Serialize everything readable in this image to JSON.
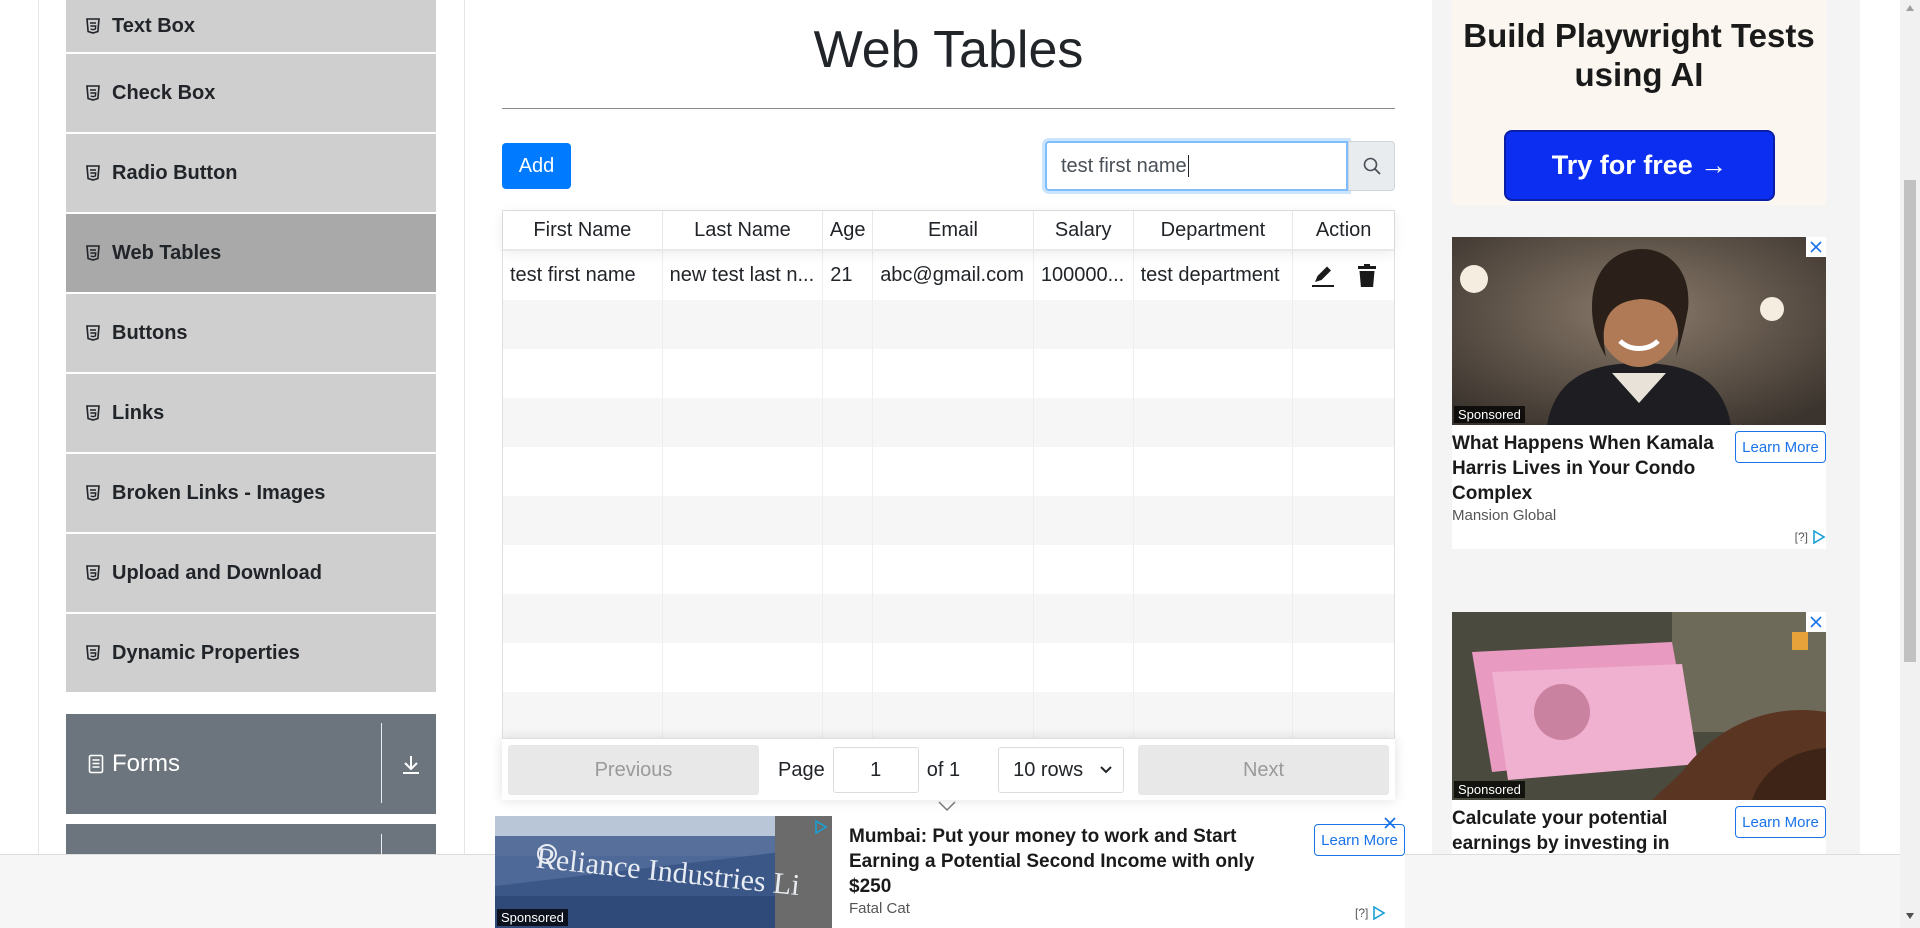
{
  "sidebar": {
    "items": [
      {
        "label": "Text Box"
      },
      {
        "label": "Check Box"
      },
      {
        "label": "Radio Button"
      },
      {
        "label": "Web Tables"
      },
      {
        "label": "Buttons"
      },
      {
        "label": "Links"
      },
      {
        "label": "Broken Links - Images"
      },
      {
        "label": "Upload and Download"
      },
      {
        "label": "Dynamic Properties"
      }
    ],
    "active_item": "Web Tables",
    "group_forms": "Forms"
  },
  "main": {
    "title": "Web Tables",
    "add_label": "Add",
    "search_value": "test first name",
    "table": {
      "headers": [
        "First Name",
        "Last Name",
        "Age",
        "Email",
        "Salary",
        "Department",
        "Action"
      ],
      "rows": [
        [
          "test first name",
          "new test last n...",
          "21",
          "abc@gmail.com",
          "100000...",
          "test department"
        ]
      ]
    },
    "pagination": {
      "previous": "Previous",
      "page_label": "Page",
      "page_value": "1",
      "of_label": "of 1",
      "rows_option": "10 rows",
      "next": "Next"
    }
  },
  "ads": {
    "top": {
      "headline": "Build Playwright Tests using AI",
      "cta": "Try for free →"
    },
    "card1": {
      "sponsored": "Sponsored",
      "headline": "What Happens When Kamala Harris Lives in Your Condo Complex",
      "learn": "Learn More",
      "source": "Mansion Global",
      "q": "[?]"
    },
    "card2": {
      "sponsored": "Sponsored",
      "headline": "Calculate your potential earnings by investing in",
      "learn": "Learn More"
    },
    "bottom": {
      "sponsored": "Sponsored",
      "image_text": "Reliance Industries Li",
      "headline": "Mumbai: Put your money to work and Start Earning a Potential Second Income with only $250",
      "source": "Fatal Cat",
      "learn": "Learn More",
      "q": "[?]"
    }
  },
  "colors": {
    "primary": "#007bff",
    "nav_bg": "#cfcfcf",
    "nav_active": "#a9a9a9",
    "group_bg": "#6c757d",
    "ad_cta": "#0c2ef0"
  }
}
